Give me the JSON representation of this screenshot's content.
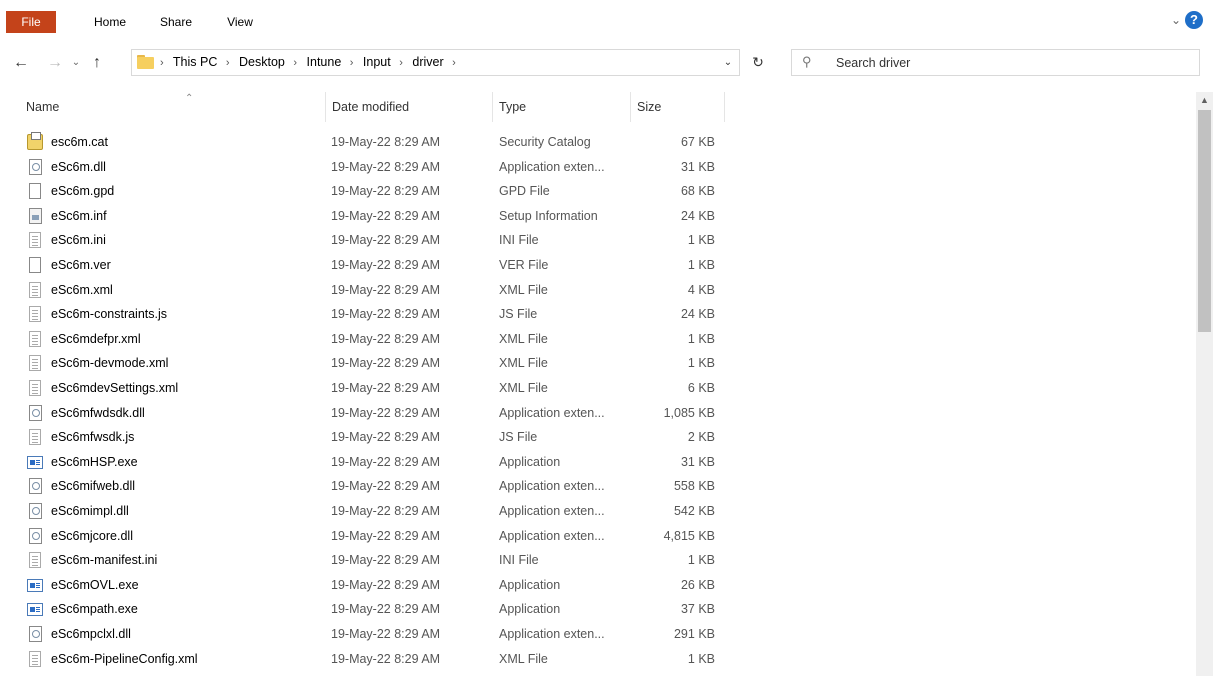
{
  "ribbon": {
    "tabs": [
      "File",
      "Home",
      "Share",
      "View"
    ],
    "help_label": "?"
  },
  "address": {
    "crumbs": [
      "This PC",
      "Desktop",
      "Intune",
      "Input",
      "driver"
    ]
  },
  "search": {
    "placeholder": "Search driver"
  },
  "columns": {
    "name": "Name",
    "date": "Date modified",
    "type": "Type",
    "size": "Size"
  },
  "files": [
    {
      "name": "esc6m.cat",
      "date": "19-May-22 8:29 AM",
      "type": "Security Catalog",
      "size": "67 KB",
      "icon": "catalog-icon"
    },
    {
      "name": "eSc6m.dll",
      "date": "19-May-22 8:29 AM",
      "type": "Application exten...",
      "size": "31 KB",
      "icon": "dll-icon"
    },
    {
      "name": "eSc6m.gpd",
      "date": "19-May-22 8:29 AM",
      "type": "GPD File",
      "size": "68 KB",
      "icon": "generic-file-icon"
    },
    {
      "name": "eSc6m.inf",
      "date": "19-May-22 8:29 AM",
      "type": "Setup Information",
      "size": "24 KB",
      "icon": "setup-info-icon"
    },
    {
      "name": "eSc6m.ini",
      "date": "19-May-22 8:29 AM",
      "type": "INI File",
      "size": "1 KB",
      "icon": "text-file-icon"
    },
    {
      "name": "eSc6m.ver",
      "date": "19-May-22 8:29 AM",
      "type": "VER File",
      "size": "1 KB",
      "icon": "generic-file-icon"
    },
    {
      "name": "eSc6m.xml",
      "date": "19-May-22 8:29 AM",
      "type": "XML File",
      "size": "4 KB",
      "icon": "text-file-icon"
    },
    {
      "name": "eSc6m-constraints.js",
      "date": "19-May-22 8:29 AM",
      "type": "JS File",
      "size": "24 KB",
      "icon": "text-file-icon"
    },
    {
      "name": "eSc6mdefpr.xml",
      "date": "19-May-22 8:29 AM",
      "type": "XML File",
      "size": "1 KB",
      "icon": "text-file-icon"
    },
    {
      "name": "eSc6m-devmode.xml",
      "date": "19-May-22 8:29 AM",
      "type": "XML File",
      "size": "1 KB",
      "icon": "text-file-icon"
    },
    {
      "name": "eSc6mdevSettings.xml",
      "date": "19-May-22 8:29 AM",
      "type": "XML File",
      "size": "6 KB",
      "icon": "text-file-icon"
    },
    {
      "name": "eSc6mfwdsdk.dll",
      "date": "19-May-22 8:29 AM",
      "type": "Application exten...",
      "size": "1,085 KB",
      "icon": "dll-icon"
    },
    {
      "name": "eSc6mfwsdk.js",
      "date": "19-May-22 8:29 AM",
      "type": "JS File",
      "size": "2 KB",
      "icon": "text-file-icon"
    },
    {
      "name": "eSc6mHSP.exe",
      "date": "19-May-22 8:29 AM",
      "type": "Application",
      "size": "31 KB",
      "icon": "exe-icon"
    },
    {
      "name": "eSc6mifweb.dll",
      "date": "19-May-22 8:29 AM",
      "type": "Application exten...",
      "size": "558 KB",
      "icon": "dll-icon"
    },
    {
      "name": "eSc6mimpl.dll",
      "date": "19-May-22 8:29 AM",
      "type": "Application exten...",
      "size": "542 KB",
      "icon": "dll-icon"
    },
    {
      "name": "eSc6mjcore.dll",
      "date": "19-May-22 8:29 AM",
      "type": "Application exten...",
      "size": "4,815 KB",
      "icon": "dll-icon"
    },
    {
      "name": "eSc6m-manifest.ini",
      "date": "19-May-22 8:29 AM",
      "type": "INI File",
      "size": "1 KB",
      "icon": "text-file-icon"
    },
    {
      "name": "eSc6mOVL.exe",
      "date": "19-May-22 8:29 AM",
      "type": "Application",
      "size": "26 KB",
      "icon": "exe-icon"
    },
    {
      "name": "eSc6mpath.exe",
      "date": "19-May-22 8:29 AM",
      "type": "Application",
      "size": "37 KB",
      "icon": "exe-icon"
    },
    {
      "name": "eSc6mpclxl.dll",
      "date": "19-May-22 8:29 AM",
      "type": "Application exten...",
      "size": "291 KB",
      "icon": "dll-icon"
    },
    {
      "name": "eSc6m-PipelineConfig.xml",
      "date": "19-May-22 8:29 AM",
      "type": "XML File",
      "size": "1 KB",
      "icon": "text-file-icon"
    }
  ],
  "colors": {
    "file_tab": "#c4431a",
    "help": "#1e6ec8",
    "folder": "#f6cf5f"
  }
}
